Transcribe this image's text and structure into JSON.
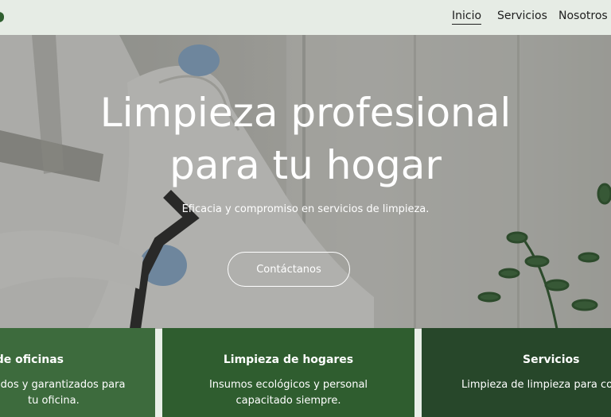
{
  "nav": {
    "items": [
      {
        "label": "Inicio",
        "active": true
      },
      {
        "label": "Servicios",
        "active": false
      },
      {
        "label": "Nosotros",
        "active": false
      }
    ]
  },
  "hero": {
    "title_line1": "Limpieza profesional",
    "title_line2": "para tu hogar",
    "subtitle": "Eficacia y compromiso en servicios de limpieza.",
    "cta_label": "Contáctanos"
  },
  "cards": [
    {
      "title": "pieza de oficinas",
      "line1": "idos y garantizados para",
      "line2": "tu oficina.",
      "color": "#3d6b3d"
    },
    {
      "title": "Limpieza de hogares",
      "line1": "Insumos ecológicos y personal",
      "line2": "capacitado siempre.",
      "color": "#2f5d2f"
    },
    {
      "title": "Servicios",
      "line1": "Limpieza de limpieza para come",
      "line2": "",
      "color": "#27472a"
    }
  ],
  "colors": {
    "brand_green": "#2f5f2f",
    "nav_bg": "#e6ece5",
    "text_white": "#ffffff"
  },
  "icons": {
    "logo": "logo-mark-icon"
  }
}
